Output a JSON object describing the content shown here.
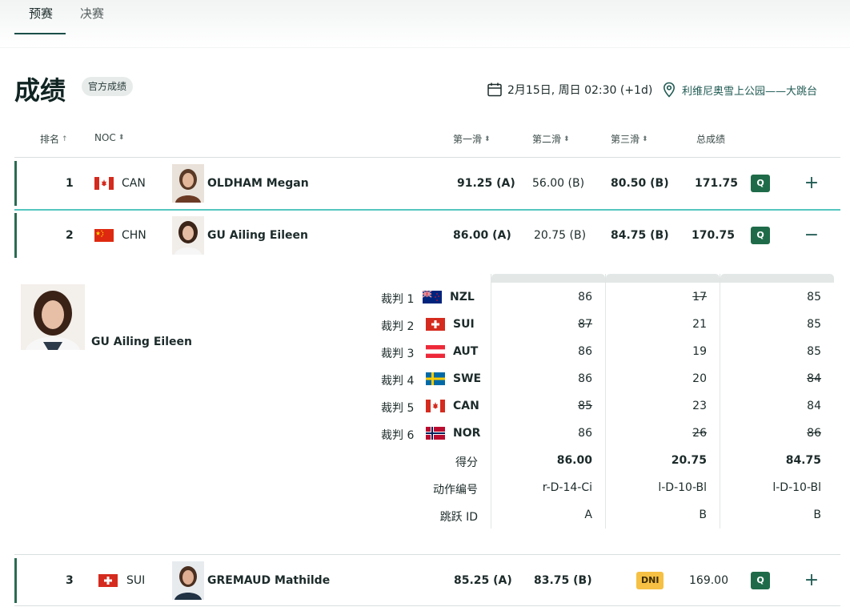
{
  "tabs": [
    {
      "label": "预赛",
      "active": true
    },
    {
      "label": "决赛",
      "active": false
    }
  ],
  "header": {
    "title": "成绩",
    "badge": "官方成绩",
    "date": "2月15日, 周日 02:30 (+1d)",
    "venue": "利维尼奥雪上公园——大跳台"
  },
  "columns": {
    "rank": "排名",
    "noc": "NOC",
    "run1": "第一滑",
    "run2": "第二滑",
    "run3": "第三滑",
    "total": "总成绩"
  },
  "rows": [
    {
      "rank": "1",
      "noc": "CAN",
      "name": "OLDHAM Megan",
      "run1": "91.25 (A)",
      "run2": "56.00 (B)",
      "run3": "80.50 (B)",
      "total": "171.75",
      "status": "Q",
      "toggle": "+"
    },
    {
      "rank": "2",
      "noc": "CHN",
      "name": "GU Ailing Eileen",
      "run1": "86.00 (A)",
      "run2": "20.75 (B)",
      "run3": "84.75 (B)",
      "total": "170.75",
      "status": "Q",
      "toggle": "−"
    },
    {
      "rank": "3",
      "noc": "SUI",
      "name": "GREMAUD Mathilde",
      "run1": "85.25 (A)",
      "run2": "83.75 (B)",
      "run3": "DNI",
      "total": "169.00",
      "status": "Q",
      "toggle": "+"
    }
  ],
  "detail": {
    "name": "GU Ailing Eileen",
    "judges": [
      {
        "label": "裁判 1",
        "noc": "NZL",
        "scores": [
          "86",
          "17",
          "85"
        ],
        "struck": [
          false,
          true,
          false
        ]
      },
      {
        "label": "裁判 2",
        "noc": "SUI",
        "scores": [
          "87",
          "21",
          "85"
        ],
        "struck": [
          true,
          false,
          false
        ]
      },
      {
        "label": "裁判 3",
        "noc": "AUT",
        "scores": [
          "86",
          "19",
          "85"
        ],
        "struck": [
          false,
          false,
          false
        ]
      },
      {
        "label": "裁判 4",
        "noc": "SWE",
        "scores": [
          "86",
          "20",
          "84"
        ],
        "struck": [
          false,
          false,
          true
        ]
      },
      {
        "label": "裁判 5",
        "noc": "CAN",
        "scores": [
          "85",
          "23",
          "84"
        ],
        "struck": [
          true,
          false,
          false
        ]
      },
      {
        "label": "裁判 6",
        "noc": "NOR",
        "scores": [
          "86",
          "26",
          "86"
        ],
        "struck": [
          false,
          true,
          true
        ]
      }
    ],
    "score_label": "得分",
    "scores": [
      "86.00",
      "20.75",
      "84.75"
    ],
    "trick_label": "动作编号",
    "tricks": [
      "r-D-14-Ci",
      "l-D-10-Bl",
      "l-D-10-Bl"
    ],
    "jump_label": "跳跃 ID",
    "jumps": [
      "A",
      "B",
      "B"
    ]
  },
  "colors": {
    "accent": "#1b4e49",
    "qualified": "#1f6b49",
    "dni": "#f5c043",
    "expanded_line": "#55c6c0"
  }
}
